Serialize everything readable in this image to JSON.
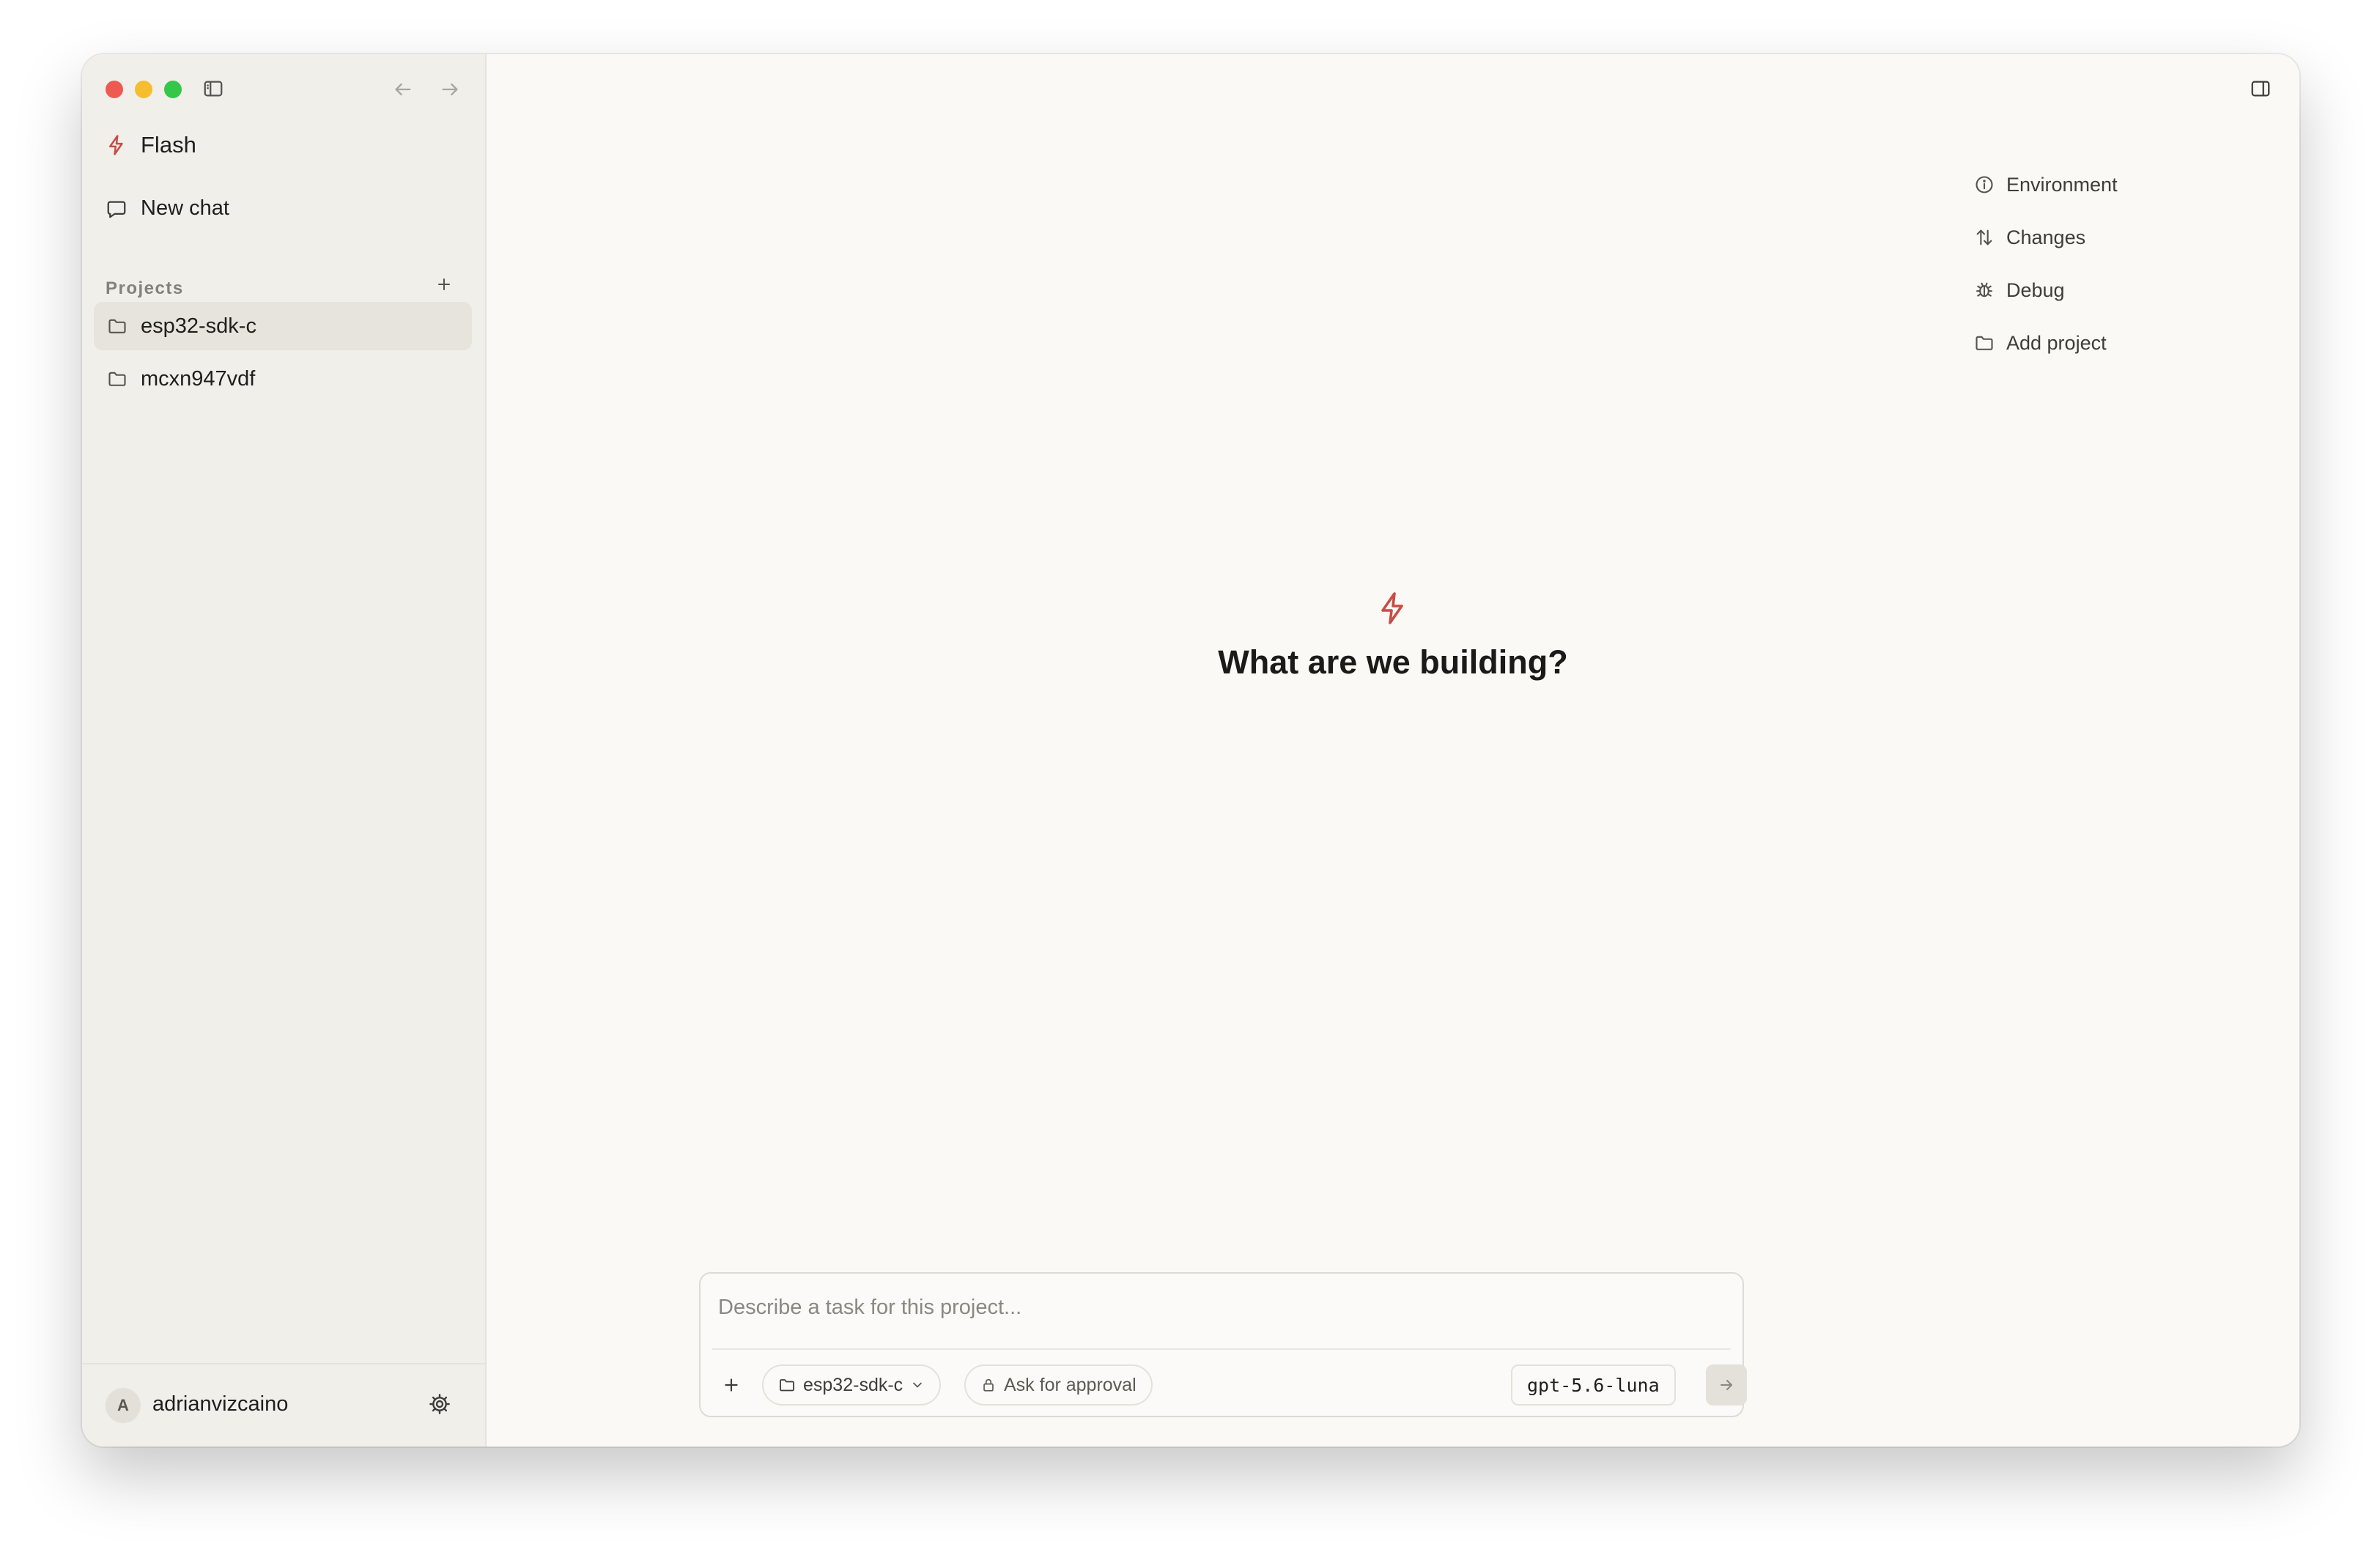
{
  "app": {
    "name": "Flash",
    "accent_color": "#c94c46"
  },
  "sidebar": {
    "new_chat_label": "New chat",
    "projects_label": "Projects",
    "projects": [
      {
        "name": "esp32-sdk-c",
        "active": true
      },
      {
        "name": "mcxn947vdf",
        "active": false
      }
    ],
    "user": {
      "avatar_initial": "A",
      "username": "adrianvizcaino"
    }
  },
  "right_menu": {
    "items": [
      {
        "label": "Environment",
        "icon": "info-icon"
      },
      {
        "label": "Changes",
        "icon": "arrows-up-down-icon"
      },
      {
        "label": "Debug",
        "icon": "bug-icon"
      },
      {
        "label": "Add project",
        "icon": "folder-icon"
      }
    ]
  },
  "hero": {
    "title": "What are we building?"
  },
  "composer": {
    "placeholder": "Describe a task for this project...",
    "project_chip": "esp32-sdk-c",
    "approval_chip": "Ask for approval",
    "model": "gpt-5.6-luna"
  }
}
